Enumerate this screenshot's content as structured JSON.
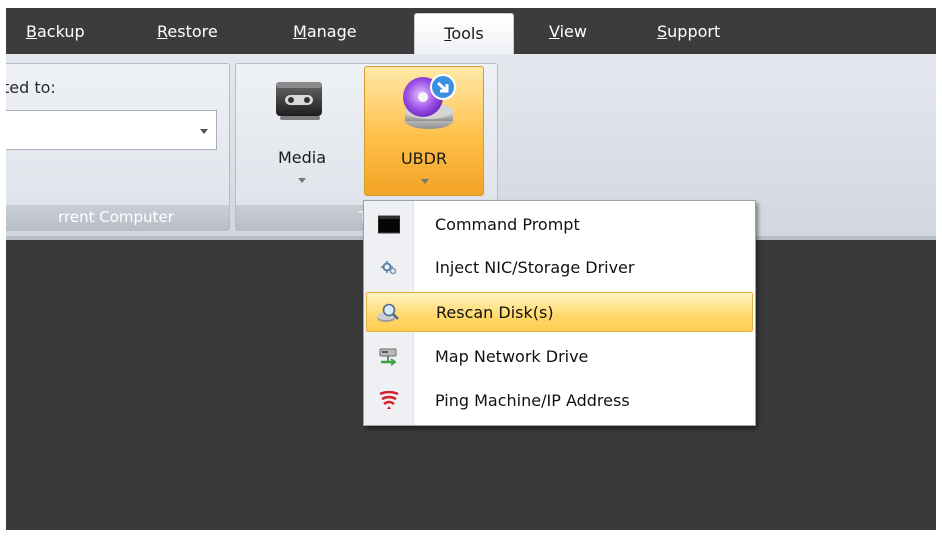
{
  "tabs": [
    {
      "mnemonic": "B",
      "rest": "ackup"
    },
    {
      "mnemonic": "R",
      "rest": "estore"
    },
    {
      "mnemonic": "M",
      "rest": "anage"
    },
    {
      "mnemonic": "T",
      "rest": "ools"
    },
    {
      "mnemonic": "V",
      "rest": "iew"
    },
    {
      "mnemonic": "S",
      "rest": "upport"
    }
  ],
  "active_tab": "Tools",
  "ribbon": {
    "group1": {
      "field_label": "ted to:",
      "combo_value": "",
      "group_label": "rrent Computer"
    },
    "group2": {
      "media_label": "Media",
      "ubdr_label": "UBDR",
      "group_label": "To"
    }
  },
  "menu": {
    "items": [
      {
        "label": "Command Prompt",
        "icon": "command-prompt-icon"
      },
      {
        "label": "Inject NIC/Storage Driver",
        "icon": "inject-driver-icon"
      },
      {
        "label": "Rescan Disk(s)",
        "icon": "rescan-disk-icon"
      },
      {
        "label": "Map Network Drive",
        "icon": "map-network-drive-icon"
      },
      {
        "label": "Ping Machine/IP Address",
        "icon": "ping-icon"
      }
    ],
    "highlighted_item": "Rescan Disk(s)"
  },
  "colors": {
    "tabbar_bg": "#3c3c3c",
    "canvas_bg": "#3a3a3a",
    "highlight": "#ffcd4f",
    "pressed_button": "#ffc04a"
  }
}
